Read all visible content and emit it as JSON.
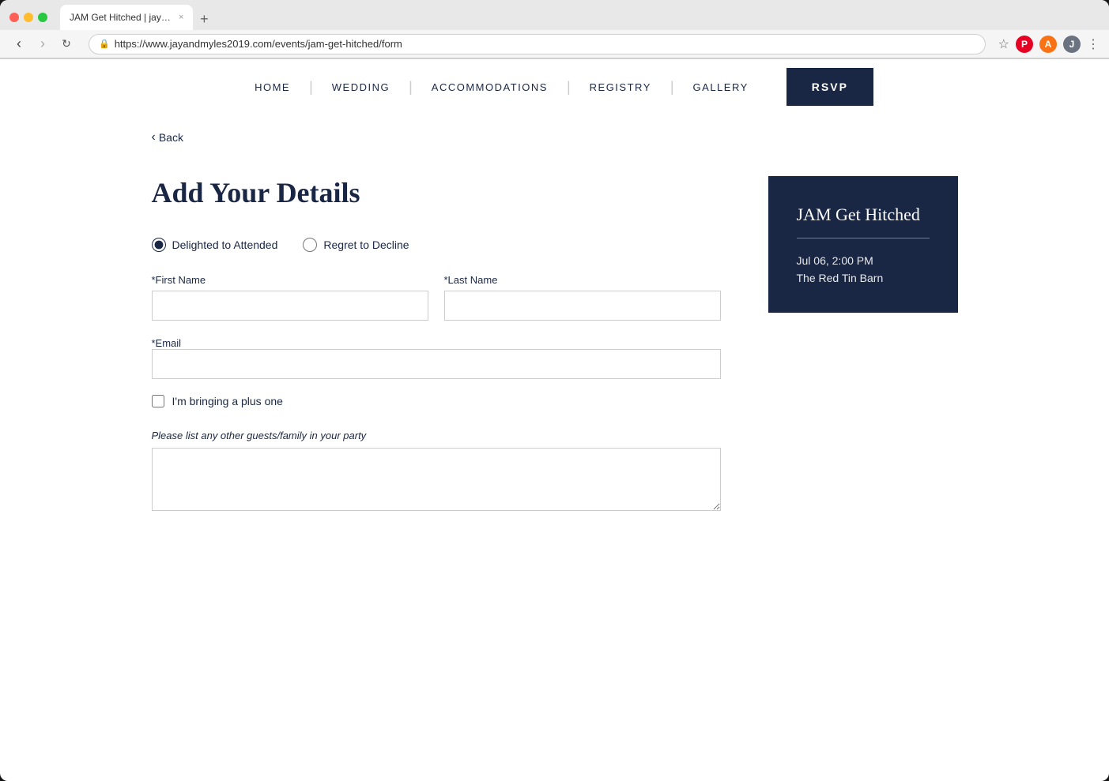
{
  "browser": {
    "tab_title": "JAM Get Hitched | jayandmyle",
    "url": "https://www.jayandmyles2019.com/events/jam-get-hitched/form",
    "close_symbol": "×",
    "new_tab_symbol": "+",
    "back_symbol": "‹",
    "forward_symbol": "›",
    "refresh_symbol": "↻",
    "lock_symbol": "🔒"
  },
  "nav": {
    "home": "HOME",
    "wedding": "WEDDING",
    "accommodations": "ACCOMMODATIONS",
    "registry": "REGISTRY",
    "gallery": "GALLERY",
    "rsvp": "RSVP"
  },
  "back_link": "Back",
  "form": {
    "title": "Add Your Details",
    "attend_label": "Delighted to Attended",
    "decline_label": "Regret to Decline",
    "first_name_label": "*First Name",
    "last_name_label": "*Last Name",
    "email_label": "*Email",
    "plus_one_label": "I'm bringing a plus one",
    "other_guests_label": "Please list any other guests/family in your party"
  },
  "event_card": {
    "title": "JAM Get Hitched",
    "date": "Jul 06, 2:00 PM",
    "venue": "The Red Tin Barn"
  },
  "icons": {
    "pinterest": "P",
    "adblock": "A",
    "user": "J",
    "chevron_left": "‹",
    "star": "☆",
    "more": "⋮"
  }
}
